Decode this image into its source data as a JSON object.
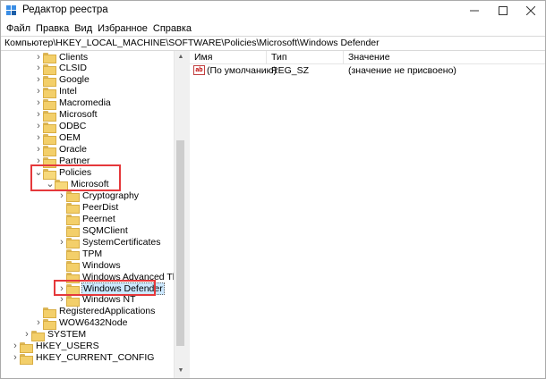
{
  "window": {
    "title": "Редактор реестра"
  },
  "menu": [
    "Файл",
    "Правка",
    "Вид",
    "Избранное",
    "Справка"
  ],
  "address": "Компьютер\\HKEY_LOCAL_MACHINE\\SOFTWARE\\Policies\\Microsoft\\Windows Defender",
  "tree": {
    "software_children": [
      {
        "label": "Clients",
        "expandable": true
      },
      {
        "label": "CLSID",
        "expandable": true
      },
      {
        "label": "Google",
        "expandable": true
      },
      {
        "label": "Intel",
        "expandable": true
      },
      {
        "label": "Macromedia",
        "expandable": true
      },
      {
        "label": "Microsoft",
        "expandable": true
      },
      {
        "label": "ODBC",
        "expandable": true
      },
      {
        "label": "OEM",
        "expandable": true
      },
      {
        "label": "Oracle",
        "expandable": true
      },
      {
        "label": "Partner",
        "expandable": true
      }
    ],
    "policies": "Policies",
    "policies_microsoft": "Microsoft",
    "microsoft_children": [
      {
        "label": "Cryptography",
        "expandable": true
      },
      {
        "label": "PeerDist",
        "expandable": false
      },
      {
        "label": "Peernet",
        "expandable": false
      },
      {
        "label": "SQMClient",
        "expandable": false
      },
      {
        "label": "SystemCertificates",
        "expandable": true
      },
      {
        "label": "TPM",
        "expandable": false
      },
      {
        "label": "Windows",
        "expandable": false
      },
      {
        "label": "Windows Advanced Threat Protection",
        "expandable": false
      },
      {
        "label": "Windows Defender",
        "expandable": true,
        "selected": true
      },
      {
        "label": "Windows NT",
        "expandable": true
      }
    ],
    "after_policies": [
      {
        "label": "RegisteredApplications",
        "expandable": false
      },
      {
        "label": "WOW6432Node",
        "expandable": true
      }
    ],
    "hklm_tail": [
      {
        "label": "SYSTEM",
        "expandable": true
      }
    ],
    "roots": [
      {
        "label": "HKEY_USERS",
        "expandable": true
      },
      {
        "label": "HKEY_CURRENT_CONFIG",
        "expandable": true
      }
    ]
  },
  "list": {
    "columns": [
      "Имя",
      "Тип",
      "Значение"
    ],
    "rows": [
      {
        "icon": "string-value-icon",
        "name": "(По умолчанию)",
        "type": "REG_SZ",
        "value": "(значение не присвоено)"
      }
    ]
  },
  "colors": {
    "highlight": "#e5383b",
    "selection": "#cce8ff",
    "folder": "#f3cf6a"
  }
}
